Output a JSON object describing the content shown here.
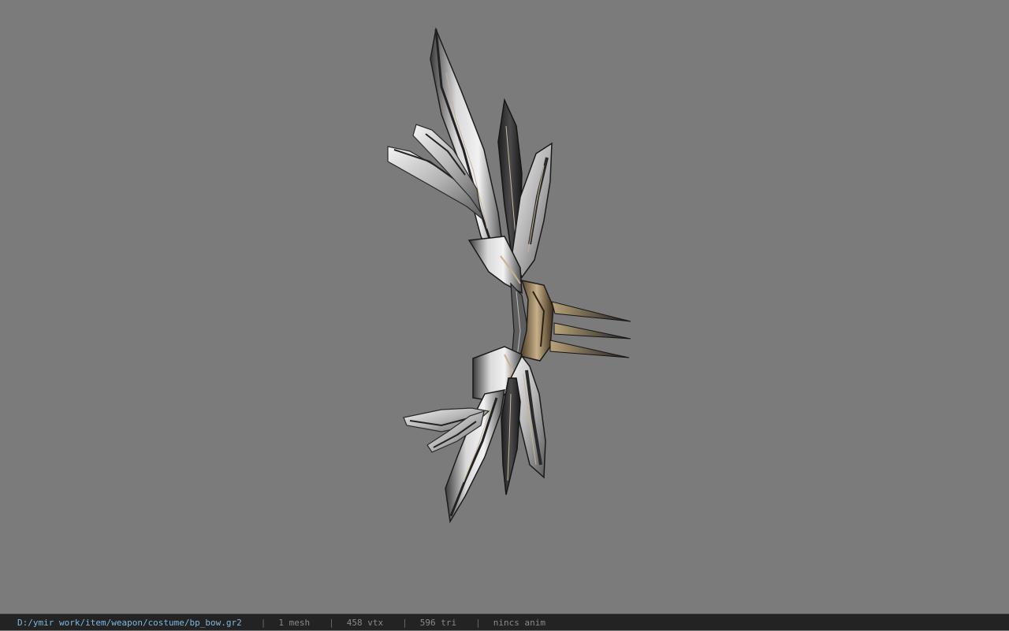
{
  "status_bar": {
    "file_path": "D:/ymir work/item/weapon/costume/bp_bow.gr2",
    "separator": "|",
    "mesh_count": "1 mesh",
    "vertex_count": "458 vtx",
    "triangle_count": "596 tri",
    "anim_status": "nincs anim"
  },
  "colors": {
    "viewport_background": "#7b7b7b",
    "status_bar_background": "#232323",
    "path_text": "#7fb8e0",
    "stat_text": "#8a8a8a"
  }
}
